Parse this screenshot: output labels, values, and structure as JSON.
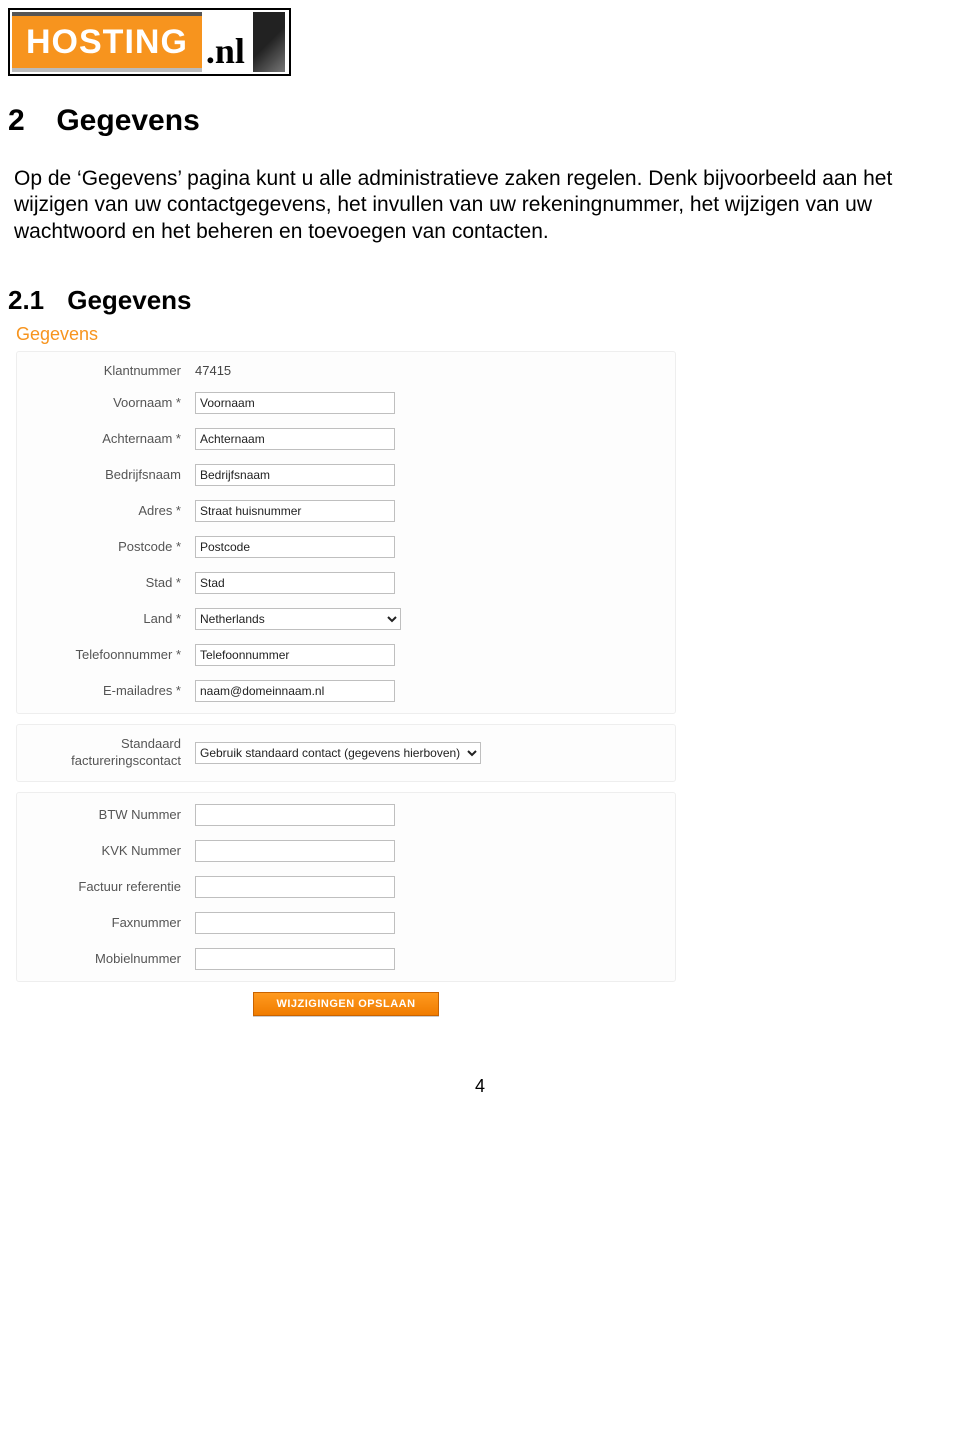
{
  "logo": {
    "brand": "HOSTING",
    "tld": ".nl"
  },
  "section": {
    "num": "2",
    "title": "Gegevens"
  },
  "intro": "Op de ‘Gegevens’ pagina kunt u alle administratieve zaken regelen. Denk bijvoorbeeld aan het wijzigen van uw contactgegevens, het invullen van uw rekeningnummer, het wijzigen van uw wachtwoord en het beheren en toevoegen van contacten.",
  "subsection": {
    "num": "2.1",
    "title": "Gegevens"
  },
  "panel": {
    "title": "Gegevens",
    "customer": {
      "klantnummer_label": "Klantnummer",
      "klantnummer_value": "47415",
      "voornaam_label": "Voornaam *",
      "voornaam_value": "Voornaam",
      "achternaam_label": "Achternaam *",
      "achternaam_value": "Achternaam",
      "bedrijf_label": "Bedrijfsnaam",
      "bedrijf_value": "Bedrijfsnaam",
      "adres_label": "Adres *",
      "adres_value": "Straat huisnummer",
      "postcode_label": "Postcode *",
      "postcode_value": "Postcode",
      "stad_label": "Stad *",
      "stad_value": "Stad",
      "land_label": "Land *",
      "land_value": "Netherlands",
      "telefoon_label": "Telefoonnummer *",
      "telefoon_value": "Telefoonnummer",
      "email_label": "E-mailadres *",
      "email_value": "naam@domeinnaam.nl"
    },
    "billing": {
      "label": "Standaard factureringscontact",
      "value": "Gebruik standaard contact (gegevens hierboven)"
    },
    "extra": {
      "btw_label": "BTW Nummer",
      "btw_value": "",
      "kvk_label": "KVK Nummer",
      "kvk_value": "",
      "factuurref_label": "Factuur referentie",
      "factuurref_value": "",
      "fax_label": "Faxnummer",
      "fax_value": "",
      "mobiel_label": "Mobielnummer",
      "mobiel_value": ""
    },
    "save_button": "WIJZIGINGEN OPSLAAN"
  },
  "page_number": "4"
}
